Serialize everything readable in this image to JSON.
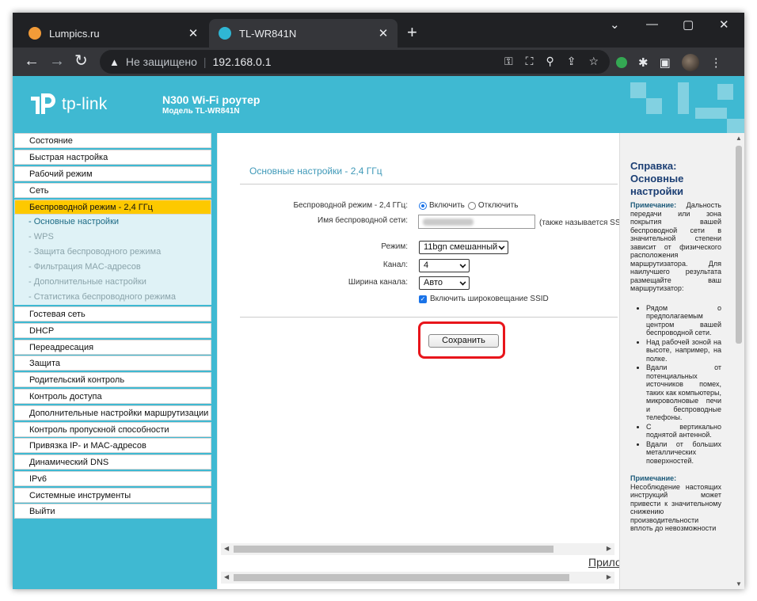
{
  "browser": {
    "tabs": [
      {
        "title": "Lumpics.ru",
        "active": false,
        "favicon_color": "#f29b38"
      },
      {
        "title": "TL-WR841N",
        "active": true,
        "favicon_color": "#2fb6d4"
      }
    ],
    "new_tab_glyph": "+",
    "close_glyph": "✕",
    "window_controls": {
      "dropdown": "⌄",
      "minimize": "—",
      "maximize": "▢",
      "close": "✕"
    },
    "nav": {
      "back": "←",
      "forward": "→",
      "reload": "↻"
    },
    "address": {
      "warning_icon": "▲",
      "security_text": "Не защищено",
      "separator": "|",
      "url": "192.168.0.1"
    },
    "omnibox_icons": [
      "key-icon",
      "translate-icon",
      "zoom-icon",
      "share-icon",
      "star-icon"
    ],
    "extension_icons": [
      "extension-green-icon",
      "puzzle-icon",
      "sidepanel-icon",
      "profile-avatar",
      "menu-dots-icon"
    ]
  },
  "router": {
    "logo_text": "tp-link",
    "product_title": "N300 Wi-Fi роутер",
    "product_model": "Модель TL-WR841N",
    "brand_color": "#3fb9d2"
  },
  "menu": {
    "items": [
      {
        "label": "Состояние",
        "type": "main"
      },
      {
        "label": "Быстрая настройка",
        "type": "main"
      },
      {
        "label": "Рабочий режим",
        "type": "main"
      },
      {
        "label": "Сеть",
        "type": "main"
      },
      {
        "label": "Беспроводной режим - 2,4 ГГц",
        "type": "main",
        "selected": true
      },
      {
        "label": "- Основные настройки",
        "type": "sub",
        "current": true
      },
      {
        "label": "- WPS",
        "type": "sub"
      },
      {
        "label": "- Защита беспроводного режима",
        "type": "sub"
      },
      {
        "label": "- Фильтрация MAC-адресов",
        "type": "sub"
      },
      {
        "label": "- Дополнительные настройки",
        "type": "sub"
      },
      {
        "label": "- Статистика беспроводного режима",
        "type": "sub"
      },
      {
        "label": "Гостевая сеть",
        "type": "main"
      },
      {
        "label": "DHCP",
        "type": "main"
      },
      {
        "label": "Переадресация",
        "type": "main"
      },
      {
        "label": "Защита",
        "type": "main"
      },
      {
        "label": "Родительский контроль",
        "type": "main"
      },
      {
        "label": "Контроль доступа",
        "type": "main"
      },
      {
        "label": "Дополнительные настройки маршрутизации",
        "type": "main"
      },
      {
        "label": "Контроль пропускной способности",
        "type": "main"
      },
      {
        "label": "Привязка IP- и MAC-адресов",
        "type": "main"
      },
      {
        "label": "Динамический DNS",
        "type": "main"
      },
      {
        "label": "IPv6",
        "type": "main"
      },
      {
        "label": "Системные инструменты",
        "type": "main"
      },
      {
        "label": "Выйти",
        "type": "main"
      }
    ]
  },
  "form": {
    "section_title": "Основные настройки - 2,4 ГГц",
    "wireless_mode_label": "Беспроводной режим - 2,4 ГГц:",
    "enable_label": "Включить",
    "disable_label": "Отключить",
    "wireless_enabled": true,
    "ssid_label": "Имя беспроводной сети:",
    "ssid_hint": "(также называется SS",
    "mode_label": "Режим:",
    "mode_value": "11bgn смешанный",
    "channel_label": "Канал:",
    "channel_value": "4",
    "width_label": "Ширина канала:",
    "width_value": "Авто",
    "broadcast_label": "Включить широковещание SSID",
    "broadcast_checked": true,
    "save_button": "Сохранить",
    "cut_off_link": "Прило"
  },
  "help": {
    "title": "Справка: Основные настройки",
    "note1_label": "Примечание:",
    "note1_text": "Дальность передачи или зона покрытия вашей беспроводной сети в значительной степени зависит от физического расположения маршрутизатора. Для наилучшего результата размещайте ваш маршрутизатор:",
    "bullets": [
      "Рядом о предполагаемым центром вашей беспроводной сети.",
      "Над рабочей зоной на высоте, например, на полке.",
      "Вдали от потенциальных источников помех, таких как компьютеры, микроволновые печи и беспроводные телефоны.",
      "С вертикально поднятой антенной.",
      "Вдали от больших металлических поверхностей."
    ],
    "note2_label": "Примечание:",
    "note2_text": "Несоблюдение настоящих инструкций может привести к значительному снижению производительности вплоть до невозможности"
  }
}
